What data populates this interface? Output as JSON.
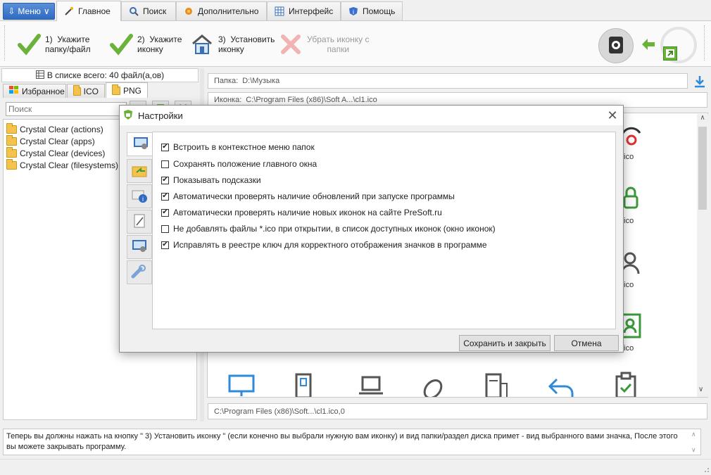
{
  "tabs": {
    "menu": "Меню",
    "main": "Главное",
    "search": "Поиск",
    "extra": "Дополнительно",
    "interface": "Интерфейс",
    "help": "Помощь"
  },
  "ribbon": {
    "step1": "1)  Укажите\nпапку/файл",
    "step2": "2)  Укажите\nиконку",
    "step3": "3)  Установить\nиконку",
    "remove": "Убрать иконку с\nпапки"
  },
  "left": {
    "count": "В списке всего: 40 файл(а,ов)",
    "tab_favorites": "Избранное",
    "tab_ico": "ICO",
    "tab_png": "PNG",
    "search_placeholder": "Поиск",
    "items": [
      "Crystal Clear (actions)",
      "Crystal Clear (apps)",
      "Crystal Clear (devices)",
      "Crystal Clear (filesystems)"
    ]
  },
  "right": {
    "folder_label": "Папка:",
    "folder_value": "D:\\Музыка",
    "icon_label": "Иконка:",
    "icon_value": "C:\\Program Files (x86)\\Soft A...\\cl1.ico",
    "captions": [
      "5.ico",
      "1.ico",
      "3.ico",
      "4.ico"
    ],
    "path_field": "C:\\Program Files (x86)\\Soft...\\cl1.ico,0"
  },
  "status": "Теперь вы должны нажать на кнопку \" 3)  Установить иконку \" (если конечно вы выбрали нужную вам иконку) и вид папки/раздел диска примет - вид выбранного вами значка, После этого вы можете закрывать программу.",
  "dialog": {
    "title": "Настройки",
    "options": [
      {
        "label": "Встроить в контекстное меню папок",
        "checked": true
      },
      {
        "label": "Сохранять положение главного окна",
        "checked": false
      },
      {
        "label": "Показывать подсказки",
        "checked": true
      },
      {
        "label": "Автоматически проверять наличие обновлений при запуске программы",
        "checked": true
      },
      {
        "label": "Автоматически проверять наличие новых иконок на сайте PreSoft.ru",
        "checked": true
      },
      {
        "label": "Не добавлять файлы *.ico при открытии, в список доступных иконок (окно иконок)",
        "checked": false
      },
      {
        "label": "Исправлять в реестре ключ для корректного отображения значков в программе",
        "checked": true
      }
    ],
    "save_button": "Сохранить и закрыть",
    "cancel_button": "Отмена"
  },
  "colors": {
    "accent": "#2f6bc2",
    "green": "#6ab23a",
    "dialog_border": "#8a8a8a"
  }
}
